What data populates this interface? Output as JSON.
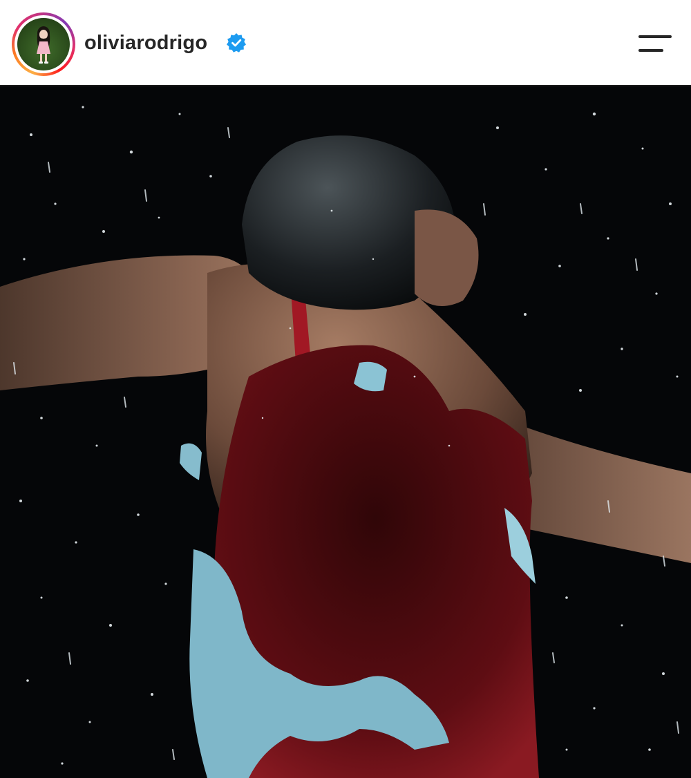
{
  "header": {
    "username": "oliviarodrigo",
    "avatar_icon": "profile-avatar",
    "verified_icon": "verified-badge-icon",
    "menu_icon": "hamburger-menu-icon",
    "story_ring_colors": [
      "#fcaf45",
      "#e1306c",
      "#833ab4"
    ],
    "verified_color": "#1d9bf0"
  },
  "post": {
    "photo_subject": "photo",
    "background_color": "#050608",
    "dress_color": "#7a1118"
  }
}
